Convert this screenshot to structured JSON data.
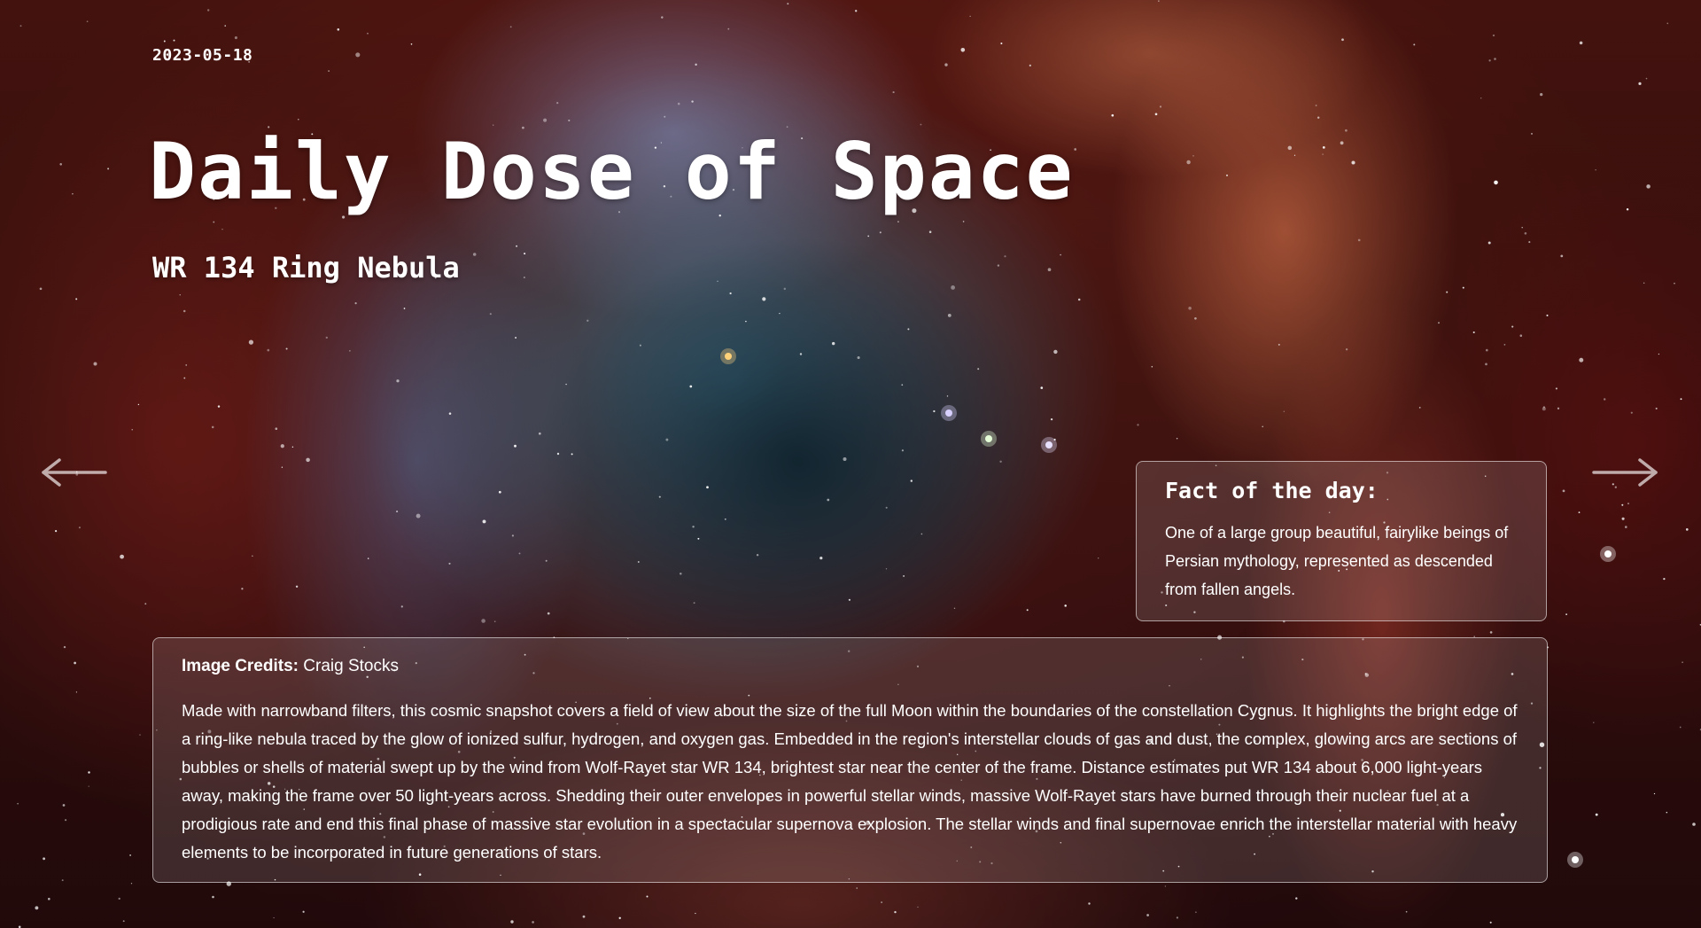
{
  "date": "2023-05-18",
  "title": "Daily Dose of Space",
  "subtitle": "WR 134 Ring Nebula",
  "navigation": {
    "prev_icon": "arrow-left-icon",
    "next_icon": "arrow-right-icon"
  },
  "fact": {
    "heading": "Fact of the day:",
    "text": "One of a large group beautiful, fairylike beings of Persian mythology, represented as descended from fallen angels."
  },
  "image_info": {
    "credits_label": "Image Credits:",
    "credits_name": "Craig Stocks",
    "description": "Made with narrowband filters, this cosmic snapshot covers a field of view about the size of the full Moon within the boundaries of the constellation Cygnus. It highlights the bright edge of a ring-like nebula traced by the glow of ionized sulfur, hydrogen, and oxygen gas. Embedded in the region's interstellar clouds of gas and dust, the complex, glowing arcs are sections of bubbles or shells of material swept up by the wind from Wolf-Rayet star WR 134, brightest star near the center of the frame. Distance estimates put WR 134 about 6,000 light-years away, making the frame over 50 light-years across. Shedding their outer envelopes in powerful stellar winds, massive Wolf-Rayet stars have burned through their nuclear fuel at a prodigious rate and end this final phase of massive star evolution in a spectacular supernova explosion. The stellar winds and final supernovae enrich the interstellar material with heavy elements to be incorporated in future generations of stars."
  },
  "colors": {
    "text": "#ffffff",
    "card_border": "rgba(255,255,255,0.55)",
    "card_fill": "rgba(255,255,255,0.13)",
    "nebula_blue": "#3c82a0",
    "nebula_red": "#7a1e16",
    "nebula_orange": "#ff8c5a"
  }
}
